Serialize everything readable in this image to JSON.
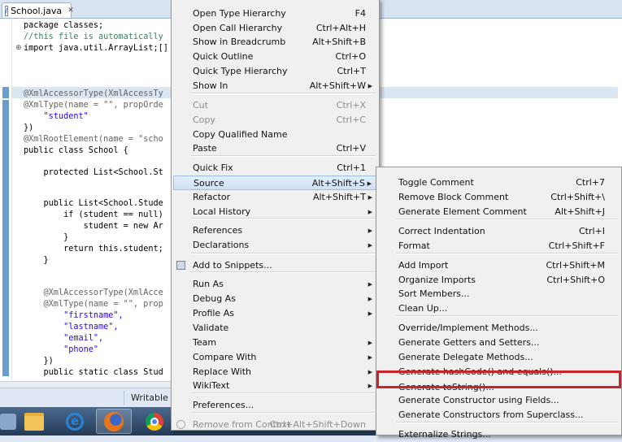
{
  "tab": {
    "filename": "School.java",
    "close_glyph": "✕"
  },
  "code_lines": [
    "package classes;",
    "//this file is automatically",
    "import java.util.ArrayList;[]",
    "",
    "",
    "@XmlAccessorType(XmlAccessTy",
    "@XmlType(name = \"\", propOrde",
    "    \"student\"",
    "})",
    "@XmlRootElement(name = \"scho",
    "public class School {",
    "",
    "    protected List<School.St",
    "",
    "",
    "    public List<School.Stude",
    "        if (student == null)",
    "            student = new Ar",
    "        }",
    "        return this.student;",
    "    }",
    "",
    "",
    "    @XmlAccessorType(XmlAcce",
    "    @XmlType(name = \"\", prop",
    "        \"firstname\",",
    "        \"lastname\",",
    "        \"email\",",
    "        \"phone\"",
    "    })",
    "    public static class Stud"
  ],
  "status": {
    "writable": "Writable"
  },
  "context_menu": {
    "items": [
      {
        "label": "Open Type Hierarchy",
        "shortcut": "F4"
      },
      {
        "label": "Open Call Hierarchy",
        "shortcut": "Ctrl+Alt+H"
      },
      {
        "label": "Show in Breadcrumb",
        "shortcut": "Alt+Shift+B"
      },
      {
        "label": "Quick Outline",
        "shortcut": "Ctrl+O"
      },
      {
        "label": "Quick Type Hierarchy",
        "shortcut": "Ctrl+T"
      },
      {
        "label": "Show In",
        "shortcut": "Alt+Shift+W"
      },
      {
        "label": "Cut",
        "shortcut": "Ctrl+X"
      },
      {
        "label": "Copy",
        "shortcut": "Ctrl+C"
      },
      {
        "label": "Copy Qualified Name",
        "shortcut": ""
      },
      {
        "label": "Paste",
        "shortcut": "Ctrl+V"
      },
      {
        "label": "Quick Fix",
        "shortcut": "Ctrl+1"
      },
      {
        "label": "Source",
        "shortcut": "Alt+Shift+S"
      },
      {
        "label": "Refactor",
        "shortcut": "Alt+Shift+T"
      },
      {
        "label": "Local History",
        "shortcut": ""
      },
      {
        "label": "References",
        "shortcut": ""
      },
      {
        "label": "Declarations",
        "shortcut": ""
      },
      {
        "label": "Add to Snippets...",
        "shortcut": ""
      },
      {
        "label": "Run As",
        "shortcut": ""
      },
      {
        "label": "Debug As",
        "shortcut": ""
      },
      {
        "label": "Profile As",
        "shortcut": ""
      },
      {
        "label": "Validate",
        "shortcut": ""
      },
      {
        "label": "Team",
        "shortcut": ""
      },
      {
        "label": "Compare With",
        "shortcut": ""
      },
      {
        "label": "Replace With",
        "shortcut": ""
      },
      {
        "label": "WikiText",
        "shortcut": ""
      },
      {
        "label": "Preferences...",
        "shortcut": ""
      },
      {
        "label": "Remove from Context",
        "shortcut": "Ctrl+Alt+Shift+Down"
      }
    ]
  },
  "source_menu": {
    "items": [
      {
        "label": "Toggle Comment",
        "shortcut": "Ctrl+7"
      },
      {
        "label": "Remove Block Comment",
        "shortcut": "Ctrl+Shift+\\"
      },
      {
        "label": "Generate Element Comment",
        "shortcut": "Alt+Shift+J"
      },
      {
        "label": "Correct Indentation",
        "shortcut": "Ctrl+I"
      },
      {
        "label": "Format",
        "shortcut": "Ctrl+Shift+F"
      },
      {
        "label": "Add Import",
        "shortcut": "Ctrl+Shift+M"
      },
      {
        "label": "Organize Imports",
        "shortcut": "Ctrl+Shift+O"
      },
      {
        "label": "Sort Members...",
        "shortcut": ""
      },
      {
        "label": "Clean Up...",
        "shortcut": ""
      },
      {
        "label": "Override/Implement Methods...",
        "shortcut": ""
      },
      {
        "label": "Generate Getters and Setters...",
        "shortcut": ""
      },
      {
        "label": "Generate Delegate Methods...",
        "shortcut": ""
      },
      {
        "label": "Generate hashCode() and equals()...",
        "shortcut": ""
      },
      {
        "label": "Generate toString()...",
        "shortcut": ""
      },
      {
        "label": "Generate Constructor using Fields...",
        "shortcut": ""
      },
      {
        "label": "Generate Constructors from Superclass...",
        "shortcut": ""
      },
      {
        "label": "Externalize Strings...",
        "shortcut": ""
      }
    ]
  },
  "colors": {
    "highlight_box": "#c8242a",
    "menu_bg": "#f0f0f0"
  }
}
